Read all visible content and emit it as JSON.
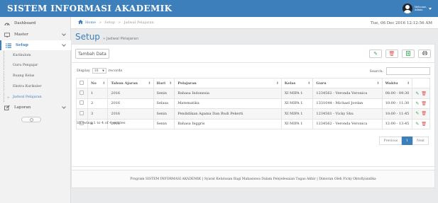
{
  "app": {
    "brand": "SISTEM INFORMASI AKADEMIK"
  },
  "user": {
    "line1": "Welcome,",
    "line2": "Admin"
  },
  "sidebar": {
    "items": [
      {
        "label": "Dashboard"
      },
      {
        "label": "Master"
      },
      {
        "label": "Setup"
      },
      {
        "label": "Laporan"
      }
    ],
    "setup_sub": [
      {
        "label": "Kurikulum"
      },
      {
        "label": "Guru Pengajar"
      },
      {
        "label": "Ruang Kelas"
      },
      {
        "label": "Ekstra Kurikuler"
      },
      {
        "label": "Jadwal Pelajaran"
      }
    ]
  },
  "breadcrumb": {
    "home": "Home",
    "setup": "Setup",
    "current": "Jadwal Pelajaran"
  },
  "datetime": "Tue, 06 Dec 2016  12:12:56 AM",
  "page": {
    "title": "Setup",
    "subtitle": "» Jadwal Pelajaran"
  },
  "toolbar": {
    "add_label": "Tambah Data"
  },
  "table_controls": {
    "display_label": "Display",
    "display_value": "10",
    "records_label": "records",
    "search_label": "Search:"
  },
  "table": {
    "headers": [
      "No",
      "Tahun Ajaran",
      "Hari",
      "Pelajaran",
      "Kelas",
      "Guru",
      "Waktu"
    ],
    "rows": [
      [
        "1",
        "2016",
        "Senin",
        "Bahasa Indonesia",
        "XI MIPA 1",
        "1234562 - Veronda Veronica",
        "08:00 - 09:30"
      ],
      [
        "2",
        "2016",
        "Selasa",
        "Matematika",
        "XI MIPA 1",
        "1331044 - Michael Jordan",
        "10:00 - 11:30"
      ],
      [
        "3",
        "2016",
        "Senin",
        "Pendidikan Agama Dan Budi Pekerti",
        "XI MIPA 1",
        "1234561 - Vicky Shu",
        "10:00 - 11:45"
      ],
      [
        "4",
        "2016",
        "Senin",
        "Bahasa Inggris",
        "XI MIPA 1",
        "1234562 - Veronda Veronica",
        "12:00 - 13:45"
      ]
    ]
  },
  "info": "Showing 1 to 4 of 4 entries",
  "pagination": {
    "prev": "Previous",
    "page": "1",
    "next": "Next"
  },
  "footer": "Program SISTEM INFORMASI AKADEMIK | Syarat Kelulusan Bagi Mahasiswa Dalam Penyelesaian Tugas Akhir | Dimoran Oleh Ficky Oktofiyandika",
  "colors": {
    "accent": "#3d7fba",
    "edit": "#2da94f",
    "delete": "#d9534f"
  }
}
